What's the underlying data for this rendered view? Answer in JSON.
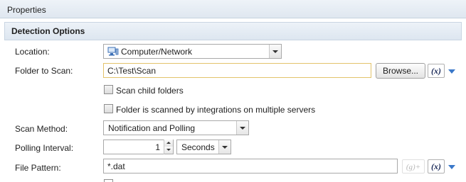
{
  "panel": {
    "title": "Properties"
  },
  "section": {
    "title": "Detection Options"
  },
  "location": {
    "label": "Location:",
    "value": "Computer/Network",
    "icon": "computer-network-icon"
  },
  "folder": {
    "label": "Folder to Scan:",
    "value": "C:\\Test\\Scan",
    "browse_label": "Browse...",
    "var_label": "(x)"
  },
  "options": {
    "scan_child": {
      "label": "Scan child folders",
      "checked": false
    },
    "multi_server": {
      "label": "Folder is scanned by integrations on multiple servers",
      "checked": false
    }
  },
  "scan_method": {
    "label": "Scan Method:",
    "value": "Notification and Polling"
  },
  "polling": {
    "label": "Polling Interval:",
    "value": "1",
    "unit": "Seconds"
  },
  "file_pattern": {
    "label": "File Pattern:",
    "value": "*.dat",
    "group_label": "(g)+",
    "var_label": "(x)"
  }
}
